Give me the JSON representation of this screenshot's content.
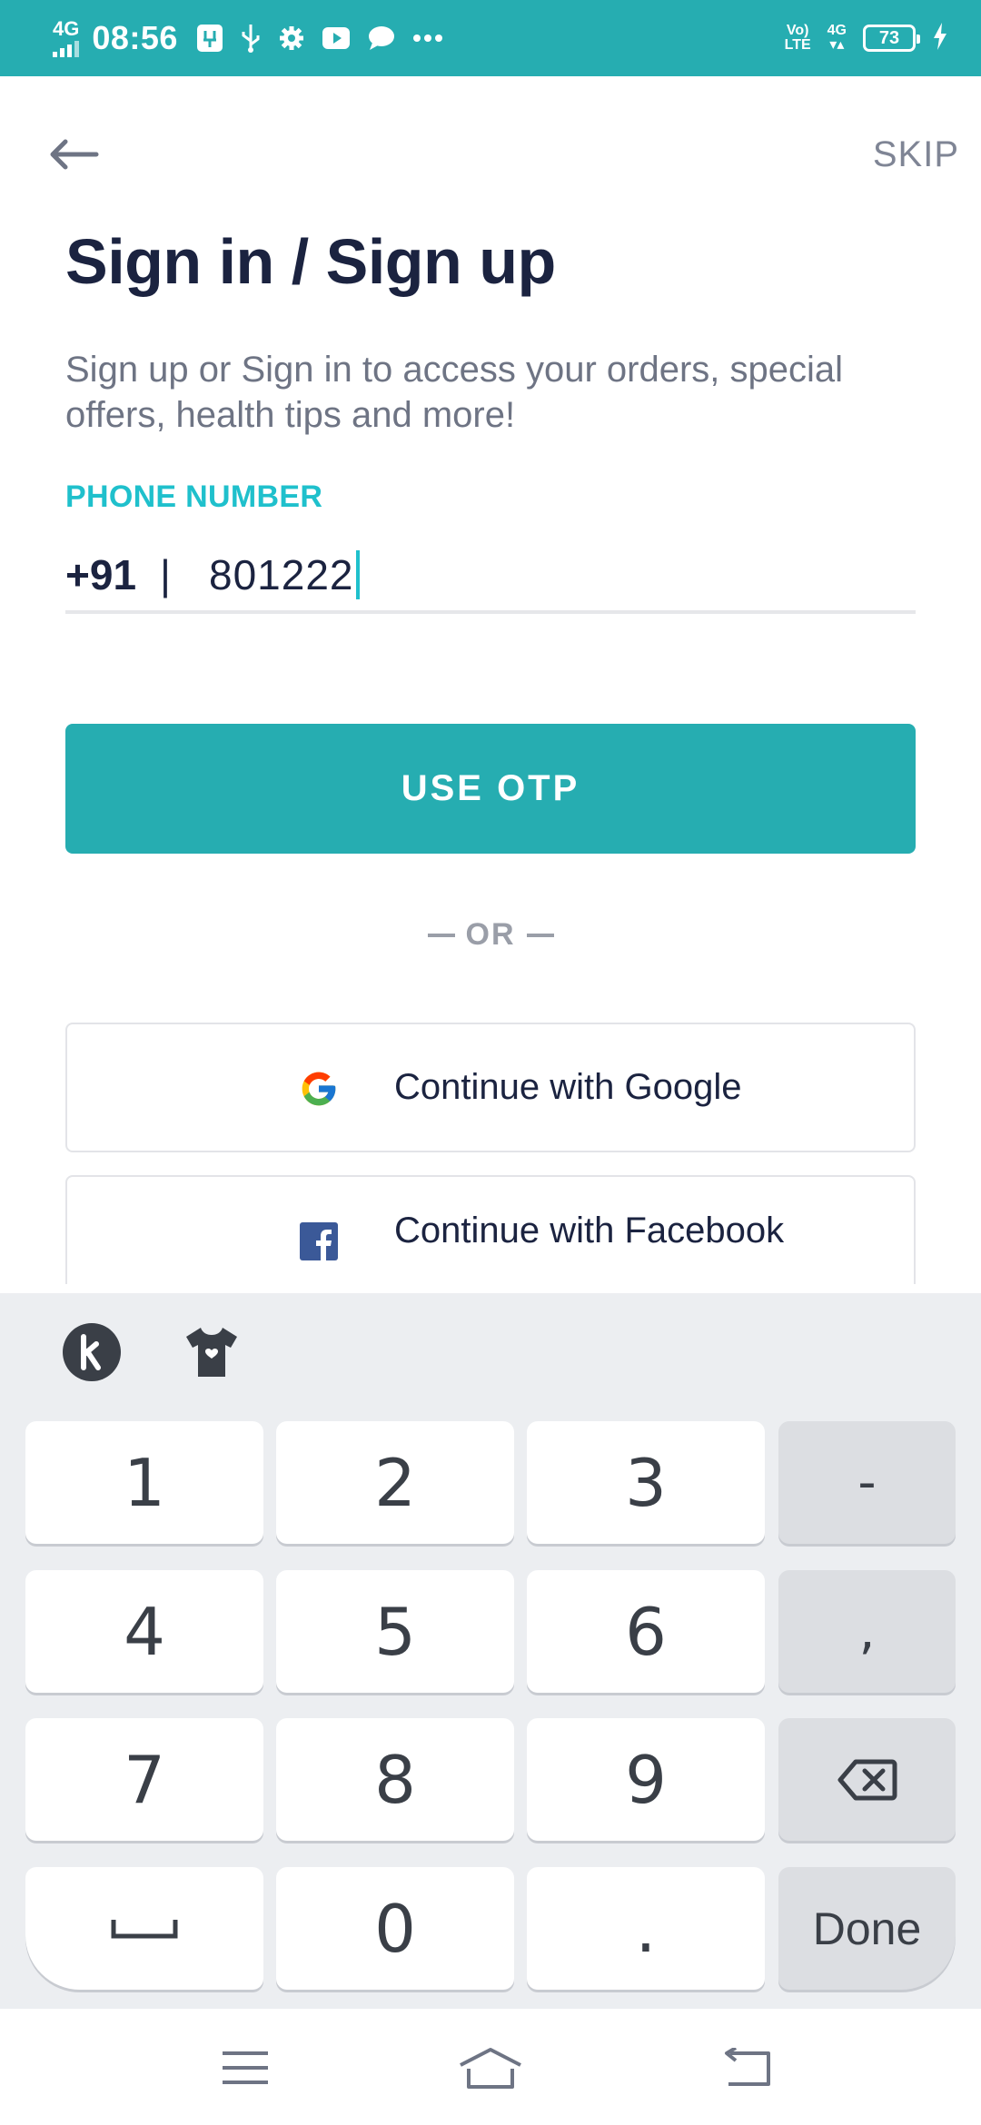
{
  "status_bar": {
    "network": "4G",
    "time": "08:56",
    "right_network": "4G",
    "volte": "Vo) LTE",
    "battery": "73"
  },
  "top_bar": {
    "skip_label": "SKIP"
  },
  "title": "Sign in / Sign up",
  "subtitle": "Sign up or Sign in to access your orders, special offers, health tips and more!",
  "phone": {
    "label": "PHONE NUMBER",
    "country_code": "+91",
    "separator": "|",
    "value": "801222"
  },
  "otp_button": "USE OTP",
  "or_text": "OR",
  "social": {
    "google_label": "Continue with Google",
    "facebook_label": "Continue with Facebook"
  },
  "keyboard": {
    "keys": {
      "k1": "1",
      "k2": "2",
      "k3": "3",
      "dash": "-",
      "k4": "4",
      "k5": "5",
      "k6": "6",
      "comma": ",",
      "k7": "7",
      "k8": "8",
      "k9": "9",
      "k0": "0",
      "dot": ".",
      "done": "Done"
    }
  },
  "colors": {
    "accent": "#26adb1",
    "label_accent": "#1fc0cc",
    "title": "#1b2340",
    "facebook": "#3b5998"
  },
  "icons": [
    "back-arrow-icon",
    "google-icon",
    "facebook-icon",
    "kika-keyboard-icon",
    "theme-shirt-icon",
    "backspace-icon",
    "space-icon",
    "menu-icon",
    "home-icon",
    "back-icon"
  ]
}
